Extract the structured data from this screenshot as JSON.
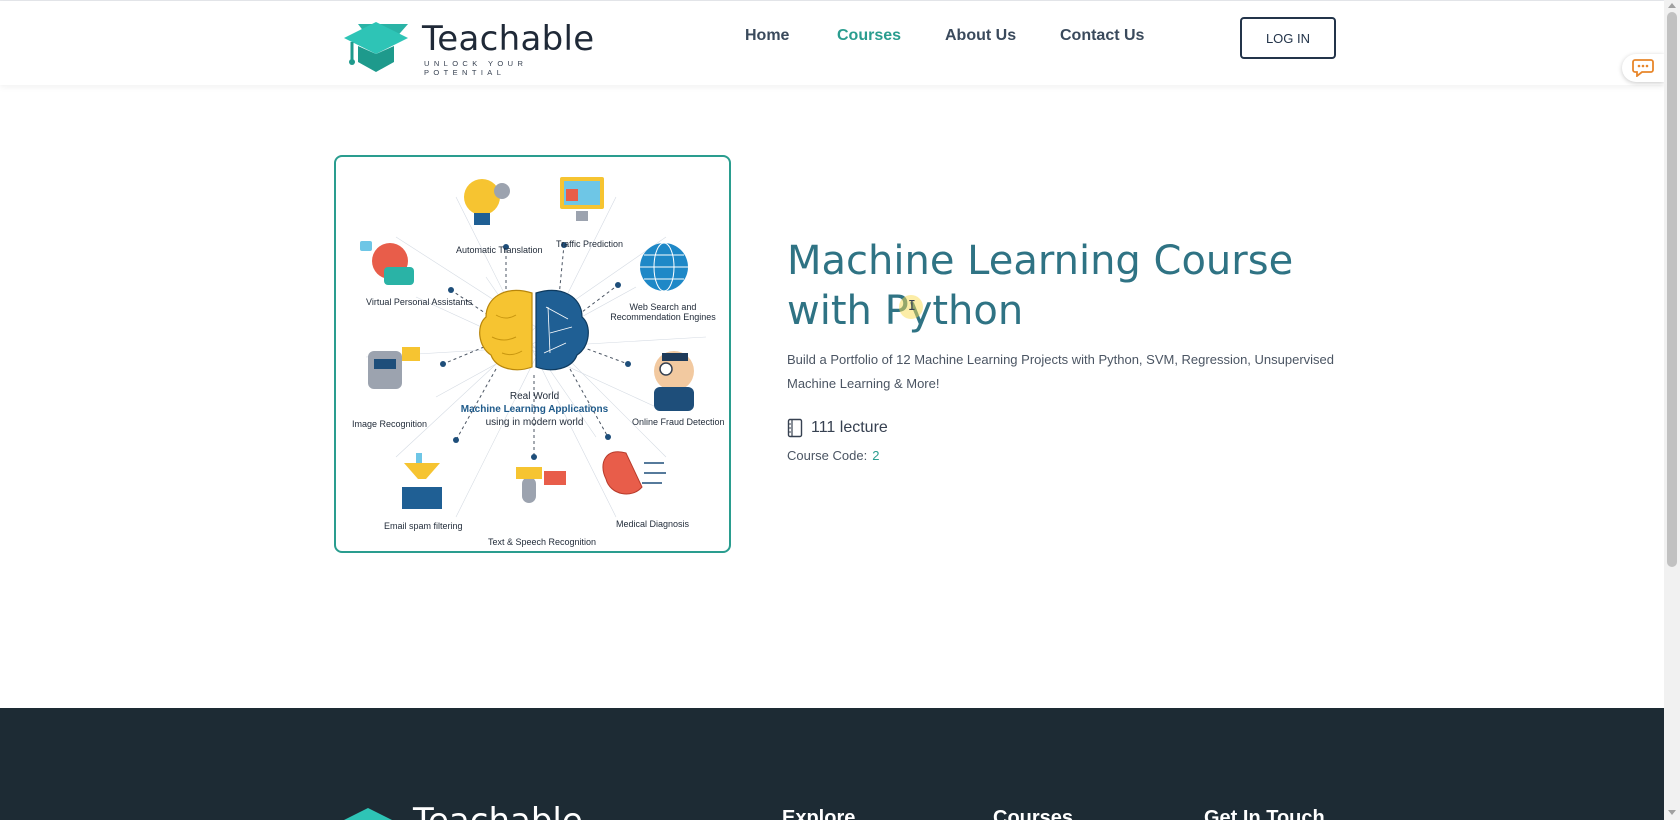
{
  "brand": {
    "name": "Teachable",
    "tagline": "UNLOCK YOUR POTENTIAL"
  },
  "nav": {
    "items": [
      {
        "label": "Home",
        "active": false
      },
      {
        "label": "Courses",
        "active": true
      },
      {
        "label": "About Us",
        "active": false
      },
      {
        "label": "Contact Us",
        "active": false
      }
    ],
    "login_label": "LOG IN"
  },
  "chat": {
    "icon": "chat-bubble-icon"
  },
  "course": {
    "title": "Machine Learning Course with Python",
    "description": "Build a Portfolio of 12 Machine Learning Projects with Python, SVM, Regression, Unsupervised Machine Learning & More!",
    "lecture_count": "111 lecture",
    "lecture_icon": "book-icon",
    "code_label": "Course Code:",
    "code_value": "2",
    "image": {
      "center_line1": "Real World",
      "center_line2": "Machine Learning Applications",
      "center_line3": "using in modern world",
      "labels": {
        "automatic_translation": "Automatic Translation",
        "traffic_prediction": "Traffic Prediction",
        "virtual_assistants": "Virtual Personal Assistants",
        "web_search": "Web Search and Recommendation Engines",
        "image_recognition": "Image Recognition",
        "fraud_detection": "Online Fraud Detection",
        "email_spam": "Email spam filtering",
        "speech_recognition": "Text & Speech Recognition",
        "medical_diagnosis": "Medical Diagnosis"
      }
    }
  },
  "footer": {
    "brand": "Teachable",
    "headings": [
      "Explore",
      "Courses",
      "Get In Touch"
    ]
  },
  "colors": {
    "accent": "#2a9d8f",
    "title": "#2f7384",
    "footer_bg": "#1d2b34",
    "nav_text": "#3a4a5c"
  }
}
